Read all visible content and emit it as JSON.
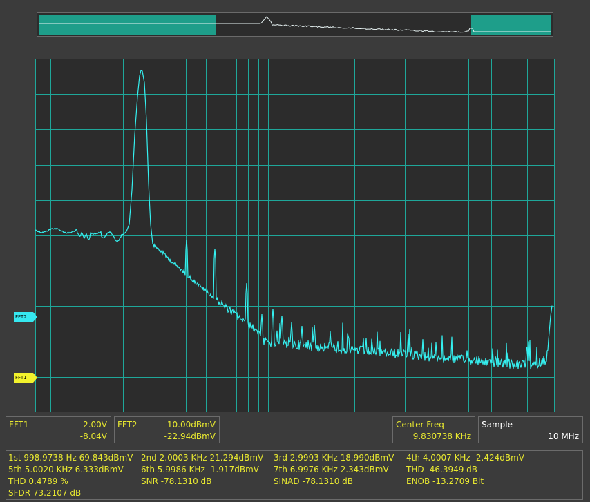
{
  "colors": {
    "background": "#3b3b3b",
    "plot_background": "#2c2c2c",
    "grid": "#1fa79a",
    "trace": "#35f0f0",
    "yellow_text": "#e8e830",
    "fft1_marker": "#f2f22c",
    "fft2_marker": "#36e8f0"
  },
  "overview": {
    "window_color": "#1e9e8a"
  },
  "markers": {
    "fft2": "FFT2",
    "fft1": "FFT1"
  },
  "channels": {
    "fft1": {
      "label": "FFT1",
      "scale": "2.00V",
      "offset": "-8.04V"
    },
    "fft2": {
      "label": "FFT2",
      "scale": "10.00dBmV",
      "offset": "-22.94dBmV"
    }
  },
  "center_freq": {
    "label": "Center Freq",
    "value": "9.830738 KHz"
  },
  "sample": {
    "label": "Sample",
    "value": "10 MHz"
  },
  "measurements": [
    [
      "1st 998.9738 Hz  69.843dBmV",
      "2nd 2.0003 KHz  21.294dBmV",
      "3rd 2.9993 KHz  18.990dBmV",
      "4th 4.0007 KHz  -2.424dBmV"
    ],
    [
      "5th 5.0020 KHz  6.333dBmV",
      "6th 5.9986 KHz  -1.917dBmV",
      "7th 6.9976 KHz  2.343dBmV",
      "THD  -46.3949 dB"
    ],
    [
      "THD  0.4789 %",
      "SNR  -78.1310 dB",
      "SINAD  -78.1310 dB",
      "ENOB  -13.2709 Bit"
    ],
    [
      "SFDR  73.2107 dB",
      "",
      "",
      ""
    ]
  ]
}
